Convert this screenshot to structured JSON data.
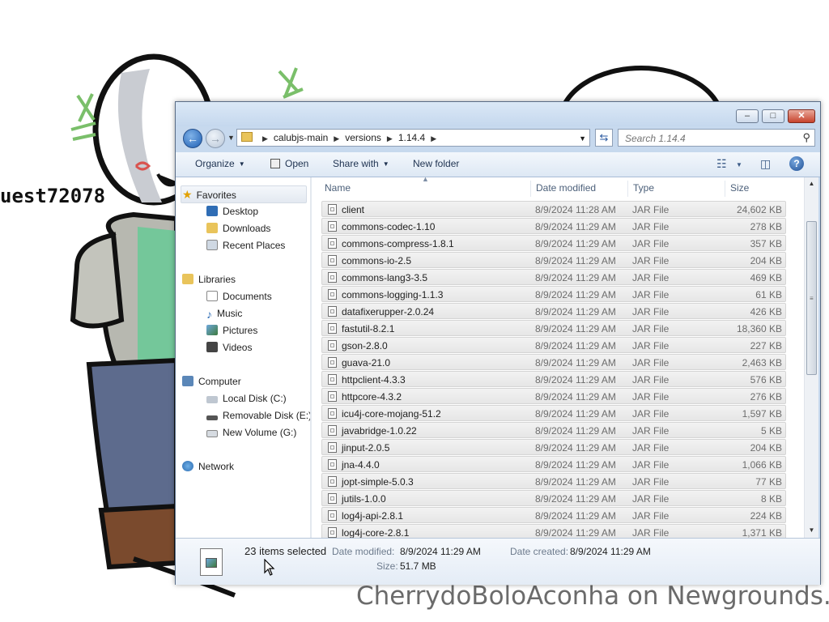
{
  "background": {
    "artist_tag": "uest72078",
    "credit": "CherrydoBoloAconha on Newgrounds."
  },
  "window": {
    "buttons": {
      "minimize": "‒",
      "maximize": "□",
      "close": "✕"
    }
  },
  "address": {
    "breadcrumbs": [
      "calubjs-main",
      "versions",
      "1.14.4"
    ],
    "search_placeholder": "Search 1.14.4"
  },
  "toolbar": {
    "organize": "Organize",
    "open": "Open",
    "share_with": "Share with",
    "new_folder": "New folder"
  },
  "nav": {
    "favorites": "Favorites",
    "favorites_items": [
      "Desktop",
      "Downloads",
      "Recent Places"
    ],
    "libraries": "Libraries",
    "libraries_items": [
      "Documents",
      "Music",
      "Pictures",
      "Videos"
    ],
    "computer": "Computer",
    "computer_items": [
      "Local Disk (C:)",
      "Removable Disk (E:)",
      "New Volume (G:)"
    ],
    "network": "Network"
  },
  "columns": {
    "name": "Name",
    "date": "Date modified",
    "type": "Type",
    "size": "Size"
  },
  "files": [
    {
      "name": "client",
      "date": "8/9/2024 11:28 AM",
      "type": "JAR File",
      "size": "24,602 KB"
    },
    {
      "name": "commons-codec-1.10",
      "date": "8/9/2024 11:29 AM",
      "type": "JAR File",
      "size": "278 KB"
    },
    {
      "name": "commons-compress-1.8.1",
      "date": "8/9/2024 11:29 AM",
      "type": "JAR File",
      "size": "357 KB"
    },
    {
      "name": "commons-io-2.5",
      "date": "8/9/2024 11:29 AM",
      "type": "JAR File",
      "size": "204 KB"
    },
    {
      "name": "commons-lang3-3.5",
      "date": "8/9/2024 11:29 AM",
      "type": "JAR File",
      "size": "469 KB"
    },
    {
      "name": "commons-logging-1.1.3",
      "date": "8/9/2024 11:29 AM",
      "type": "JAR File",
      "size": "61 KB"
    },
    {
      "name": "datafixerupper-2.0.24",
      "date": "8/9/2024 11:29 AM",
      "type": "JAR File",
      "size": "426 KB"
    },
    {
      "name": "fastutil-8.2.1",
      "date": "8/9/2024 11:29 AM",
      "type": "JAR File",
      "size": "18,360 KB"
    },
    {
      "name": "gson-2.8.0",
      "date": "8/9/2024 11:29 AM",
      "type": "JAR File",
      "size": "227 KB"
    },
    {
      "name": "guava-21.0",
      "date": "8/9/2024 11:29 AM",
      "type": "JAR File",
      "size": "2,463 KB"
    },
    {
      "name": "httpclient-4.3.3",
      "date": "8/9/2024 11:29 AM",
      "type": "JAR File",
      "size": "576 KB"
    },
    {
      "name": "httpcore-4.3.2",
      "date": "8/9/2024 11:29 AM",
      "type": "JAR File",
      "size": "276 KB"
    },
    {
      "name": "icu4j-core-mojang-51.2",
      "date": "8/9/2024 11:29 AM",
      "type": "JAR File",
      "size": "1,597 KB"
    },
    {
      "name": "javabridge-1.0.22",
      "date": "8/9/2024 11:29 AM",
      "type": "JAR File",
      "size": "5 KB"
    },
    {
      "name": "jinput-2.0.5",
      "date": "8/9/2024 11:29 AM",
      "type": "JAR File",
      "size": "204 KB"
    },
    {
      "name": "jna-4.4.0",
      "date": "8/9/2024 11:29 AM",
      "type": "JAR File",
      "size": "1,066 KB"
    },
    {
      "name": "jopt-simple-5.0.3",
      "date": "8/9/2024 11:29 AM",
      "type": "JAR File",
      "size": "77 KB"
    },
    {
      "name": "jutils-1.0.0",
      "date": "8/9/2024 11:29 AM",
      "type": "JAR File",
      "size": "8 KB"
    },
    {
      "name": "log4j-api-2.8.1",
      "date": "8/9/2024 11:29 AM",
      "type": "JAR File",
      "size": "224 KB"
    },
    {
      "name": "log4j-core-2.8.1",
      "date": "8/9/2024 11:29 AM",
      "type": "JAR File",
      "size": "1,371 KB"
    }
  ],
  "details": {
    "selected": "23 items selected",
    "date_modified_label": "Date modified:",
    "date_modified_value": "8/9/2024 11:29 AM",
    "date_created_label": "Date created:",
    "date_created_value": "8/9/2024 11:29 AM",
    "size_label": "Size:",
    "size_value": "51.7 MB"
  }
}
